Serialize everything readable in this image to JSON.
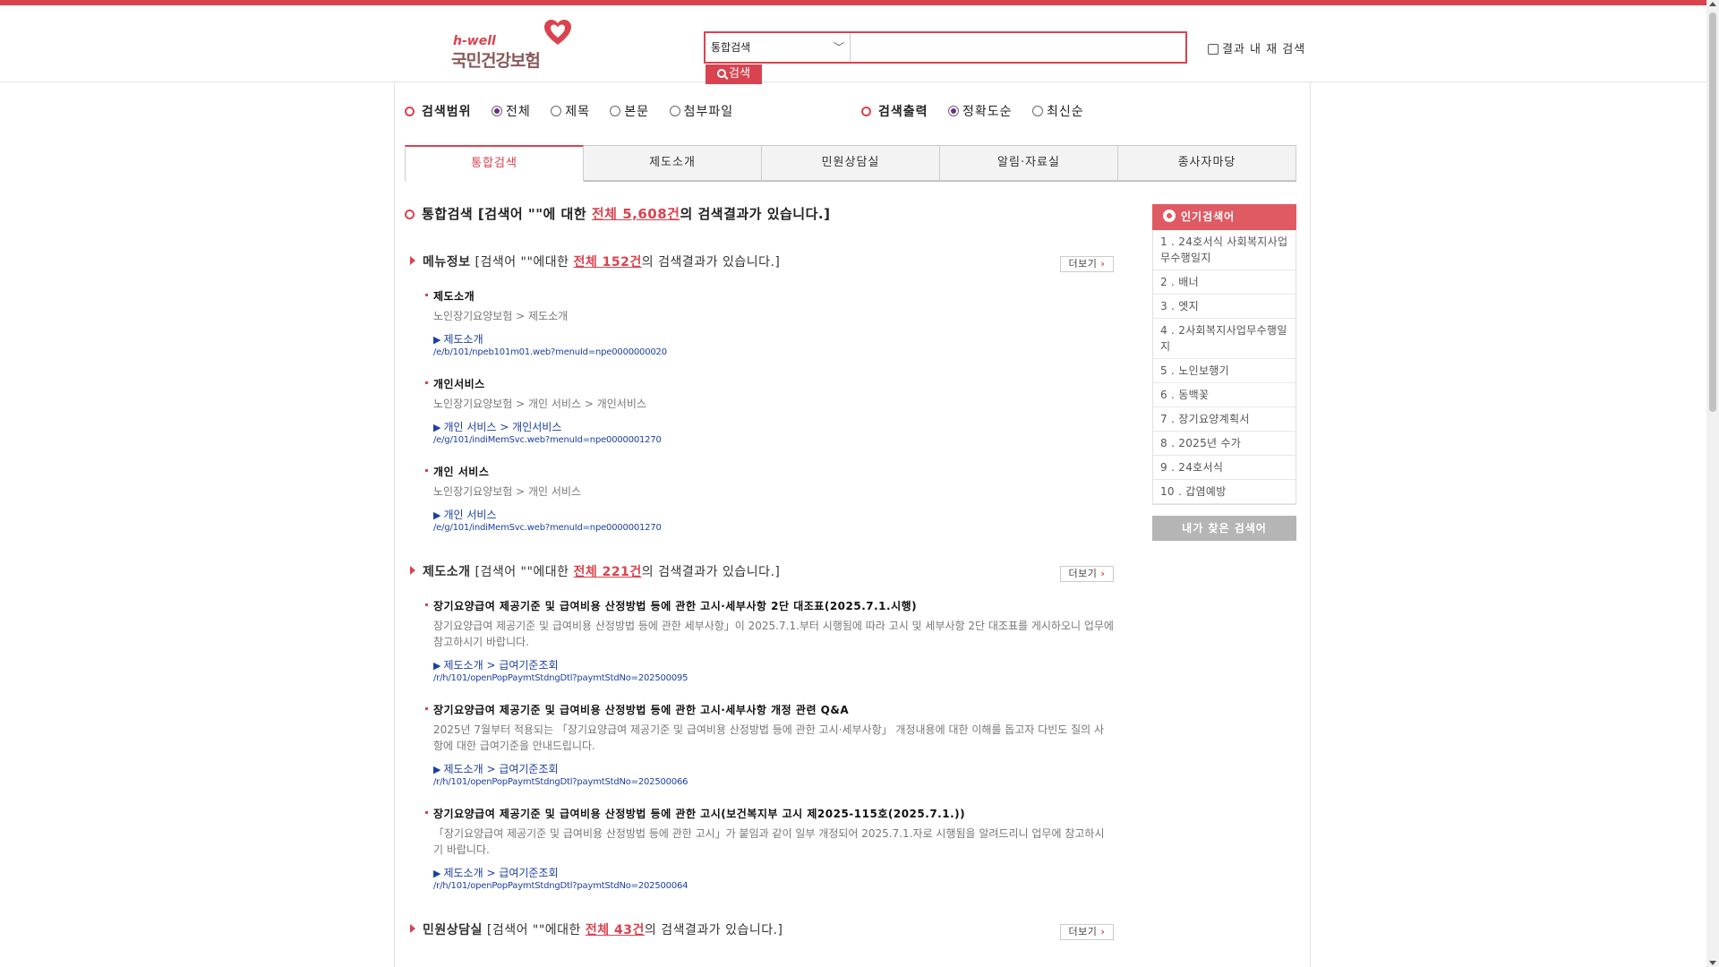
{
  "logo": {
    "sub": "h-well",
    "name": "국민건강보험"
  },
  "search": {
    "scope_selected": "통합검색",
    "input_value": "",
    "button_label": "검색",
    "within_label": "결과 내 재 검색"
  },
  "options": {
    "range_label": "검색범위",
    "range_items": [
      "전체",
      "제목",
      "본문",
      "첨부파일"
    ],
    "range_selected": "전체",
    "order_label": "검색출력",
    "order_items": [
      "정확도순",
      "최신순"
    ],
    "order_selected": "정확도순"
  },
  "tabs": [
    "통합검색",
    "제도소개",
    "민원상담실",
    "알림·자료실",
    "종사자마당"
  ],
  "active_tab": "통합검색",
  "total": {
    "prefix": "통합검색 [검색어 \"\"에 대한 ",
    "count": "전체 5,608건",
    "suffix": "의 검색결과가 있습니다.]"
  },
  "sections": [
    {
      "title": "메뉴정보",
      "prefix": " [검색어 \"\"에대한 ",
      "count": "전체 152건",
      "suffix": "의 검색결과가 있습니다.]",
      "more": "더보기",
      "items": [
        {
          "title": "제도소개",
          "path": "노인장기요양보험 > 제도소개",
          "cat": "제도소개",
          "url": "/e/b/101/npeb101m01.web?menuId=npe0000000020"
        },
        {
          "title": "개인서비스",
          "path": "노인장기요양보험 > 개인 서비스 > 개인서비스",
          "cat": "개인 서비스 > 개인서비스",
          "url": "/e/g/101/indiMemSvc.web?menuId=npe0000001270"
        },
        {
          "title": "개인 서비스",
          "path": "노인장기요양보험 > 개인 서비스",
          "cat": "개인 서비스",
          "url": "/e/g/101/indiMemSvc.web?menuId=npe0000001270"
        }
      ]
    },
    {
      "title": "제도소개",
      "prefix": " [검색어 \"\"에대한 ",
      "count": "전체 221건",
      "suffix": "의 검색결과가 있습니다.]",
      "more": "더보기",
      "items": [
        {
          "title": "장기요양급여 제공기준 및 급여비용 산정방법 등에 관한 고시·세부사항 2단 대조표(2025.7.1.시행)",
          "desc": "장기요양급여 제공기준 및 급여비용 산정방법 등에 관한 세부사항」이 2025.7.1.부터 시행됨에 따라 고시 및 세부사항 2단 대조표를 게시하오니 업무에 참고하시기 바랍니다.",
          "cat": "제도소개 > 급여기준조회",
          "url": "/r/h/101/openPopPaymtStdngDtl?paymtStdNo=202500095"
        },
        {
          "title": "장기요양급여 제공기준 및 급여비용 산정방법 등에 관한 고시·세부사항 개정 관련 Q&A",
          "desc": "2025년 7월부터 적용되는 「장기요양급여 제공기준 및 급여비용 산정방법 등에 관한 고시·세부사항」 개정내용에 대한 이해를 돕고자 다빈도 질의 사항에 대한 급여기준을 안내드립니다.",
          "cat": "제도소개 > 급여기준조회",
          "url": "/r/h/101/openPopPaymtStdngDtl?paymtStdNo=202500066"
        },
        {
          "title": "장기요양급여 제공기준 및 급여비용 산정방법 등에 관한 고시(보건복지부 고시 제2025-115호(2025.7.1.))",
          "desc": "「장기요양급여 제공기준 및 급여비용 산정방법 등에 관한 고시」가 붙임과 같이 일부 개정되어 2025.7.1.자로 시행됨을 알려드리니 업무에 참고하시기 바랍니다.",
          "cat": "제도소개 > 급여기준조회",
          "url": "/r/h/101/openPopPaymtStdngDtl?paymtStdNo=202500064"
        }
      ]
    },
    {
      "title": "민원상담실",
      "prefix": " [검색어 \"\"에대한 ",
      "count": "전체 43건",
      "suffix": "의 검색결과가 있습니다.]",
      "more": "더보기",
      "items": []
    }
  ],
  "popular": {
    "title": "인기검색어",
    "items": [
      "1 . 24호서식 사회복지사업 무수행일지",
      "2 . 배너",
      "3 . 엣지",
      "4 . 2사회복지사업무수행일지",
      "5 . 노인보행기",
      "6 . 동백꽃",
      "7 . 장기요양계획서",
      "8 . 2025년 수가",
      "9 . 24호서식",
      "10 . 갑염예방"
    ],
    "my_button": "내가 찾은 검색어"
  },
  "colors": {
    "accent": "#d9434f",
    "link": "#1a3fa6",
    "radio": "#6b2d8f"
  }
}
